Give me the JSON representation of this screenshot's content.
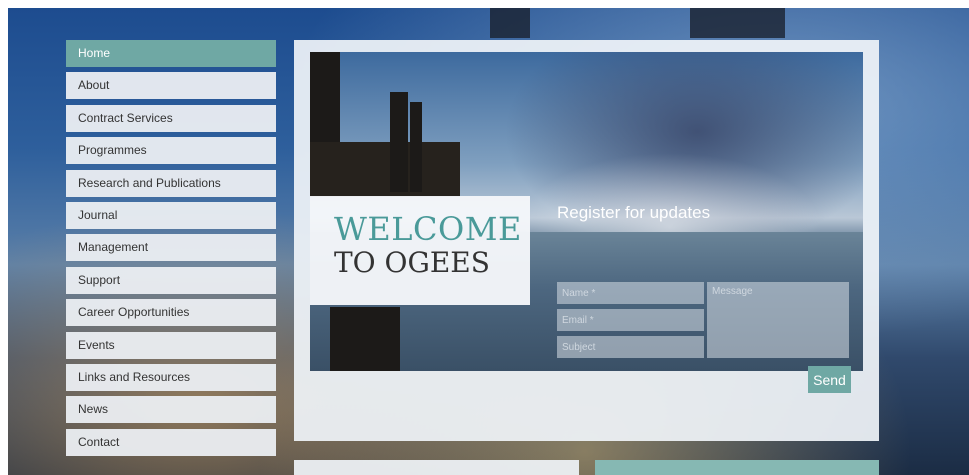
{
  "nav": {
    "items": [
      {
        "label": "Home",
        "active": true
      },
      {
        "label": "About"
      },
      {
        "label": "Contract Services"
      },
      {
        "label": "Programmes"
      },
      {
        "label": "Research and Publications"
      },
      {
        "label": "Journal"
      },
      {
        "label": "Management"
      },
      {
        "label": "Support"
      },
      {
        "label": "Career Opportunities"
      },
      {
        "label": "Events"
      },
      {
        "label": "Links and Resources"
      },
      {
        "label": "News"
      },
      {
        "label": "Contact"
      }
    ]
  },
  "hero": {
    "welcome_line1": "WELCOME",
    "welcome_line2": "TO OGEES"
  },
  "register": {
    "title": "Register for updates",
    "name_placeholder": "Name *",
    "email_placeholder": "Email *",
    "subject_placeholder": "Subject",
    "message_placeholder": "Message",
    "send_label": "Send"
  },
  "colors": {
    "accent": "#6fa8a4",
    "welcome_teal": "#4a9a99"
  }
}
